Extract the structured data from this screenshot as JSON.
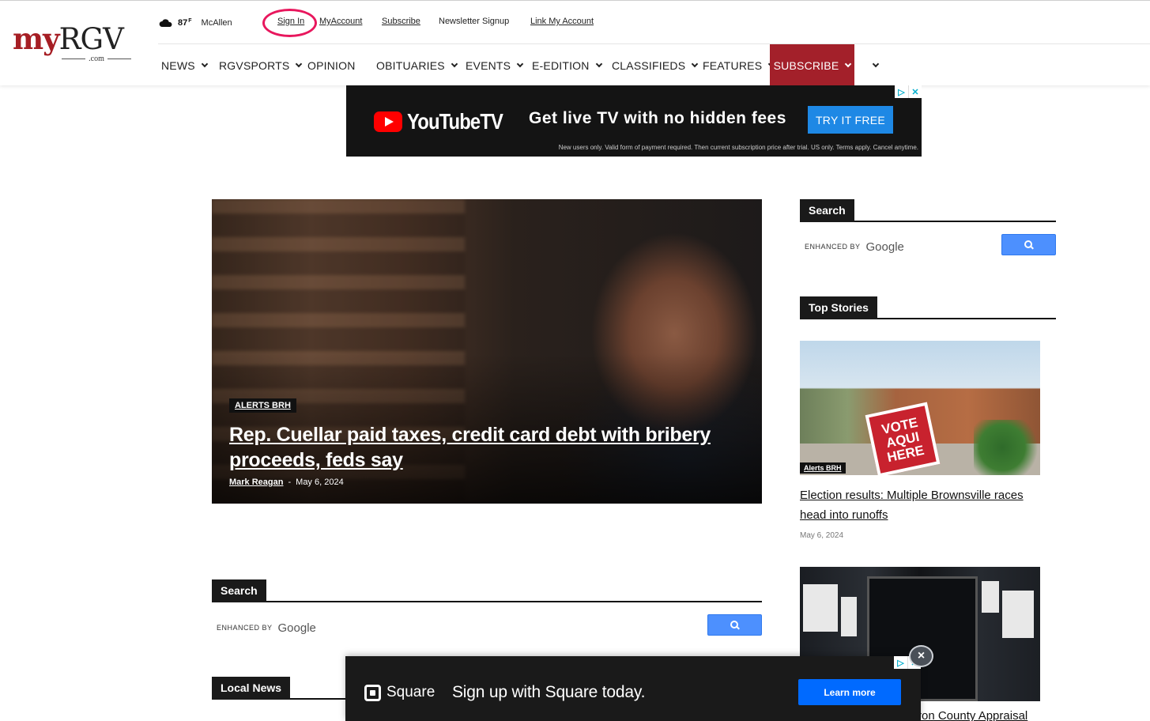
{
  "brand": {
    "logo_prefix": "my",
    "logo_main": "RGV",
    "logo_suffix": ".com"
  },
  "weather": {
    "icon": "cloud-icon",
    "temp": "87",
    "unit": "F",
    "city": "McAllen"
  },
  "top_links": [
    "Sign In",
    "MyAccount",
    "Subscribe",
    "Newsletter Signup",
    "Link My Account"
  ],
  "nav": {
    "items": [
      "NEWS",
      "RGVSPORTS",
      "OPINION",
      "OBITUARIES",
      "EVENTS",
      "E-EDITION",
      "CLASSIFIEDS",
      "FEATURES",
      "SUBSCRIBE"
    ]
  },
  "ad_top": {
    "brand": "YouTubeTV",
    "headline": "Get live TV with no hidden fees",
    "cta": "TRY IT FREE",
    "fine_print": "New users only. Valid form of payment required. Then current subscription price after trial. US only. Terms apply. Cancel anytime."
  },
  "hero": {
    "category": "ALERTS BRH",
    "title": "Rep. Cuellar paid taxes, credit card debt with bribery proceeds, feds say",
    "author": "Mark Reagan",
    "separator": "-",
    "date": "May 6, 2024"
  },
  "sidebar": {
    "search_title": "Search",
    "search_enhanced": "ENHANCED BY",
    "search_google": "Google",
    "top_stories_title": "Top Stories",
    "stories": [
      {
        "tag": "Alerts BRH",
        "title": "Election results: Multiple Brownsville races head into runoffs",
        "date": "May 6, 2024",
        "image_text": "VOTE AQUI HERE"
      },
      {
        "title_partial": "ron County Appraisal"
      }
    ]
  },
  "main_search": {
    "title": "Search",
    "enhanced": "ENHANCED BY",
    "google": "Google"
  },
  "local_news": {
    "title": "Local News"
  },
  "ad_bottom": {
    "brand": "Square",
    "headline": "Sign up with Square today.",
    "cta": "Learn more",
    "close": "×"
  },
  "colors": {
    "accent": "#a3202a",
    "highlight_ring": "#e8175d",
    "search_button": "#4d90fe"
  }
}
